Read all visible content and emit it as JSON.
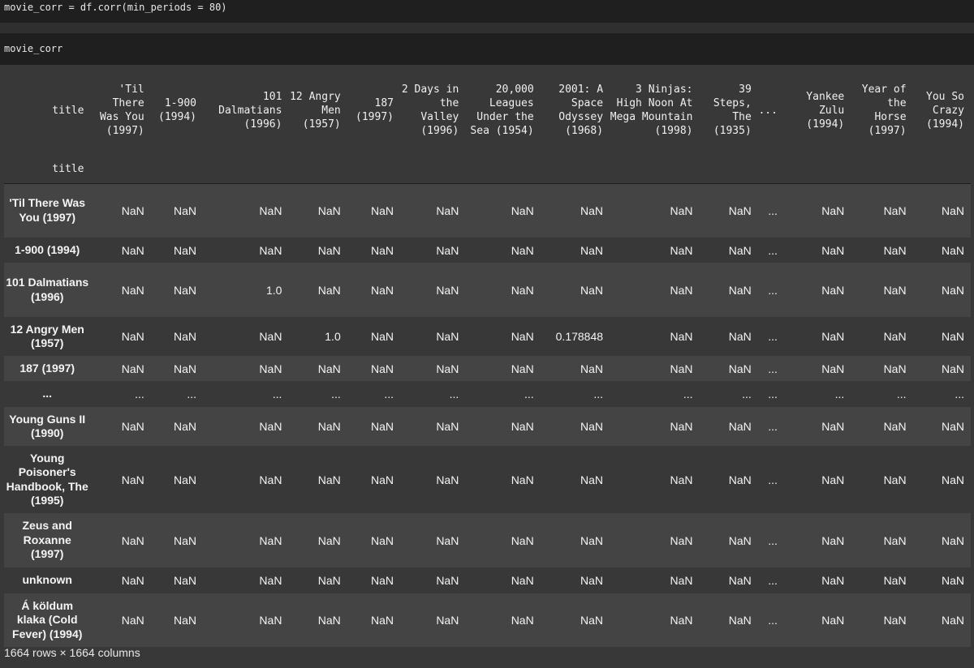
{
  "cells": {
    "input1": "movie_corr = df.corr(min_periods = 80)",
    "input2": "movie_corr"
  },
  "table": {
    "index_name": "title",
    "columns": [
      "'Til There Was You (1997)",
      "1-900 (1994)",
      "101 Dalmatians (1996)",
      "12 Angry Men (1957)",
      "187 (1997)",
      "2 Days in the Valley (1996)",
      "20,000 Leagues Under the Sea (1954)",
      "2001: A Space Odyssey (1968)",
      "3 Ninjas: High Noon At Mega Mountain (1998)",
      "39 Steps, The (1935)",
      "...",
      "Yankee Zulu (1994)",
      "Year of the Horse (1997)",
      "You So Crazy (1994)"
    ],
    "rows": [
      {
        "label": "'Til There Was You (1997)",
        "values": [
          "NaN",
          "NaN",
          "NaN",
          "NaN",
          "NaN",
          "NaN",
          "NaN",
          "NaN",
          "NaN",
          "NaN",
          "...",
          "NaN",
          "NaN",
          "NaN"
        ]
      },
      {
        "label": "1-900 (1994)",
        "values": [
          "NaN",
          "NaN",
          "NaN",
          "NaN",
          "NaN",
          "NaN",
          "NaN",
          "NaN",
          "NaN",
          "NaN",
          "...",
          "NaN",
          "NaN",
          "NaN"
        ]
      },
      {
        "label": "101 Dalmatians (1996)",
        "values": [
          "NaN",
          "NaN",
          "1.0",
          "NaN",
          "NaN",
          "NaN",
          "NaN",
          "NaN",
          "NaN",
          "NaN",
          "...",
          "NaN",
          "NaN",
          "NaN"
        ]
      },
      {
        "label": "12 Angry Men (1957)",
        "values": [
          "NaN",
          "NaN",
          "NaN",
          "1.0",
          "NaN",
          "NaN",
          "NaN",
          "0.178848",
          "NaN",
          "NaN",
          "...",
          "NaN",
          "NaN",
          "NaN"
        ]
      },
      {
        "label": "187 (1997)",
        "values": [
          "NaN",
          "NaN",
          "NaN",
          "NaN",
          "NaN",
          "NaN",
          "NaN",
          "NaN",
          "NaN",
          "NaN",
          "...",
          "NaN",
          "NaN",
          "NaN"
        ]
      },
      {
        "label": "...",
        "values": [
          "...",
          "...",
          "...",
          "...",
          "...",
          "...",
          "...",
          "...",
          "...",
          "...",
          "...",
          "...",
          "...",
          "..."
        ]
      },
      {
        "label": "Young Guns II (1990)",
        "values": [
          "NaN",
          "NaN",
          "NaN",
          "NaN",
          "NaN",
          "NaN",
          "NaN",
          "NaN",
          "NaN",
          "NaN",
          "...",
          "NaN",
          "NaN",
          "NaN"
        ]
      },
      {
        "label": "Young Poisoner's Handbook, The (1995)",
        "values": [
          "NaN",
          "NaN",
          "NaN",
          "NaN",
          "NaN",
          "NaN",
          "NaN",
          "NaN",
          "NaN",
          "NaN",
          "...",
          "NaN",
          "NaN",
          "NaN"
        ]
      },
      {
        "label": "Zeus and Roxanne (1997)",
        "values": [
          "NaN",
          "NaN",
          "NaN",
          "NaN",
          "NaN",
          "NaN",
          "NaN",
          "NaN",
          "NaN",
          "NaN",
          "...",
          "NaN",
          "NaN",
          "NaN"
        ]
      },
      {
        "label": "unknown",
        "values": [
          "NaN",
          "NaN",
          "NaN",
          "NaN",
          "NaN",
          "NaN",
          "NaN",
          "NaN",
          "NaN",
          "NaN",
          "...",
          "NaN",
          "NaN",
          "NaN"
        ]
      },
      {
        "label": "Á köldum klaka (Cold Fever) (1994)",
        "values": [
          "NaN",
          "NaN",
          "NaN",
          "NaN",
          "NaN",
          "NaN",
          "NaN",
          "NaN",
          "NaN",
          "NaN",
          "...",
          "NaN",
          "NaN",
          "NaN"
        ]
      }
    ],
    "shape_text": "1664 rows × 1664 columns"
  }
}
